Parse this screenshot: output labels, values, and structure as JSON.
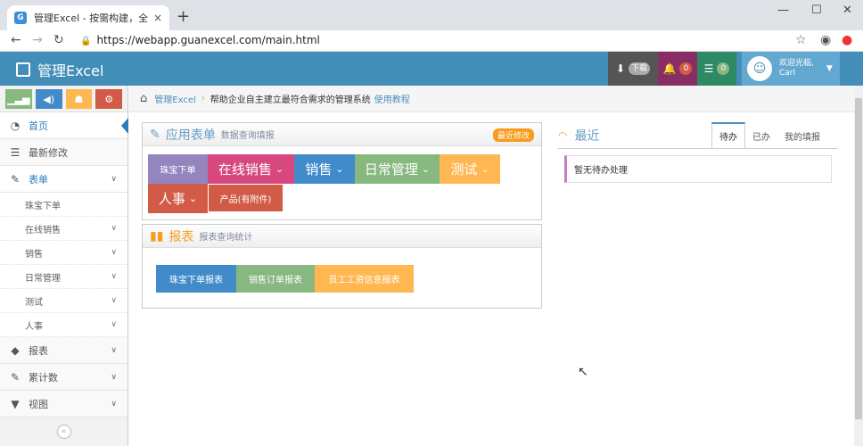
{
  "browser": {
    "tab_title": "管理Excel - 按需构建，全方位满",
    "tab_favicon": "G",
    "close": "×",
    "new_tab": "+",
    "win_min": "—",
    "win_max": "☐",
    "win_close": "✕",
    "url": "https://webapp.guanexcel.com/main.html"
  },
  "app": {
    "logo": "管理Excel",
    "download_label": "下载",
    "notif_count": "0",
    "msg_count": "0",
    "welcome": "欢迎光临,",
    "user_name": "Carl"
  },
  "sidebar": {
    "home": "首页",
    "recent": "最新修改",
    "forms": "表单",
    "sub": [
      "珠宝下单",
      "在线销售",
      "销售",
      "日常管理",
      "测试",
      "人事"
    ],
    "reports": "报表",
    "count": "累计数",
    "views": "视图",
    "collapse": "«"
  },
  "breadcrumb": {
    "home": "管理Excel",
    "desc": "帮助企业自主建立最符合需求的管理系统",
    "tutorial": "使用教程"
  },
  "forms_widget": {
    "title": "应用表单",
    "subtitle": "数据查询填报",
    "badge": "最近修改",
    "tiles": [
      {
        "label": "珠宝下单",
        "color": "#9585bf",
        "caret": ""
      },
      {
        "label": "在线销售",
        "color": "#d6487e",
        "caret": "⌄"
      },
      {
        "label": "销售",
        "color": "#428bca",
        "caret": "⌄"
      },
      {
        "label": "日常管理",
        "color": "#87b87f",
        "caret": "⌄"
      },
      {
        "label": "测试",
        "color": "#ffb752",
        "caret": "⌄"
      },
      {
        "label": "人事",
        "color": "#d15b47",
        "caret": "⌄"
      },
      {
        "label": "产品(有附件)",
        "color": "#d15b47",
        "caret": ""
      }
    ]
  },
  "reports_widget": {
    "title": "报表",
    "subtitle": "报表查询统计",
    "tiles": [
      {
        "label": "珠宝下单报表",
        "color": "#428bca"
      },
      {
        "label": "销售订单报表",
        "color": "#87b87f"
      },
      {
        "label": "员工工资信息报表",
        "color": "#ffb752"
      }
    ]
  },
  "recent": {
    "title": "最近",
    "tabs": [
      "待办",
      "已办",
      "我的填报"
    ],
    "empty": "暂无待办处理"
  }
}
